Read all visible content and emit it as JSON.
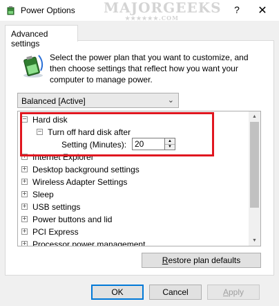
{
  "window": {
    "title": "Power Options",
    "help_label": "?",
    "close_label": "✕"
  },
  "watermark": {
    "main": "MAJORGEEKS",
    "sub": "★★★★★★.COM"
  },
  "tab": {
    "label": "Advanced settings"
  },
  "intro": {
    "text": "Select the power plan that you want to customize, and then choose settings that reflect how you want your computer to manage power."
  },
  "plan_select": {
    "value": "Balanced [Active]"
  },
  "tree": {
    "items": [
      {
        "label": "Hard disk",
        "expander": "−"
      },
      {
        "label": "Turn off hard disk after",
        "expander": "−"
      },
      {
        "label": "Setting (Minutes):",
        "value": "20"
      },
      {
        "label": "Internet Explorer",
        "expander": "+"
      },
      {
        "label": "Desktop background settings",
        "expander": "+"
      },
      {
        "label": "Wireless Adapter Settings",
        "expander": "+"
      },
      {
        "label": "Sleep",
        "expander": "+"
      },
      {
        "label": "USB settings",
        "expander": "+"
      },
      {
        "label": "Power buttons and lid",
        "expander": "+"
      },
      {
        "label": "PCI Express",
        "expander": "+"
      },
      {
        "label": "Processor power management",
        "expander": "+"
      }
    ]
  },
  "buttons": {
    "restore_first": "R",
    "restore_rest": "estore plan defaults",
    "ok": "OK",
    "cancel": "Cancel",
    "apply_first": "A",
    "apply_rest": "pply"
  },
  "colors": {
    "highlight": "#e0161f",
    "default_button_border": "#0078d7"
  }
}
